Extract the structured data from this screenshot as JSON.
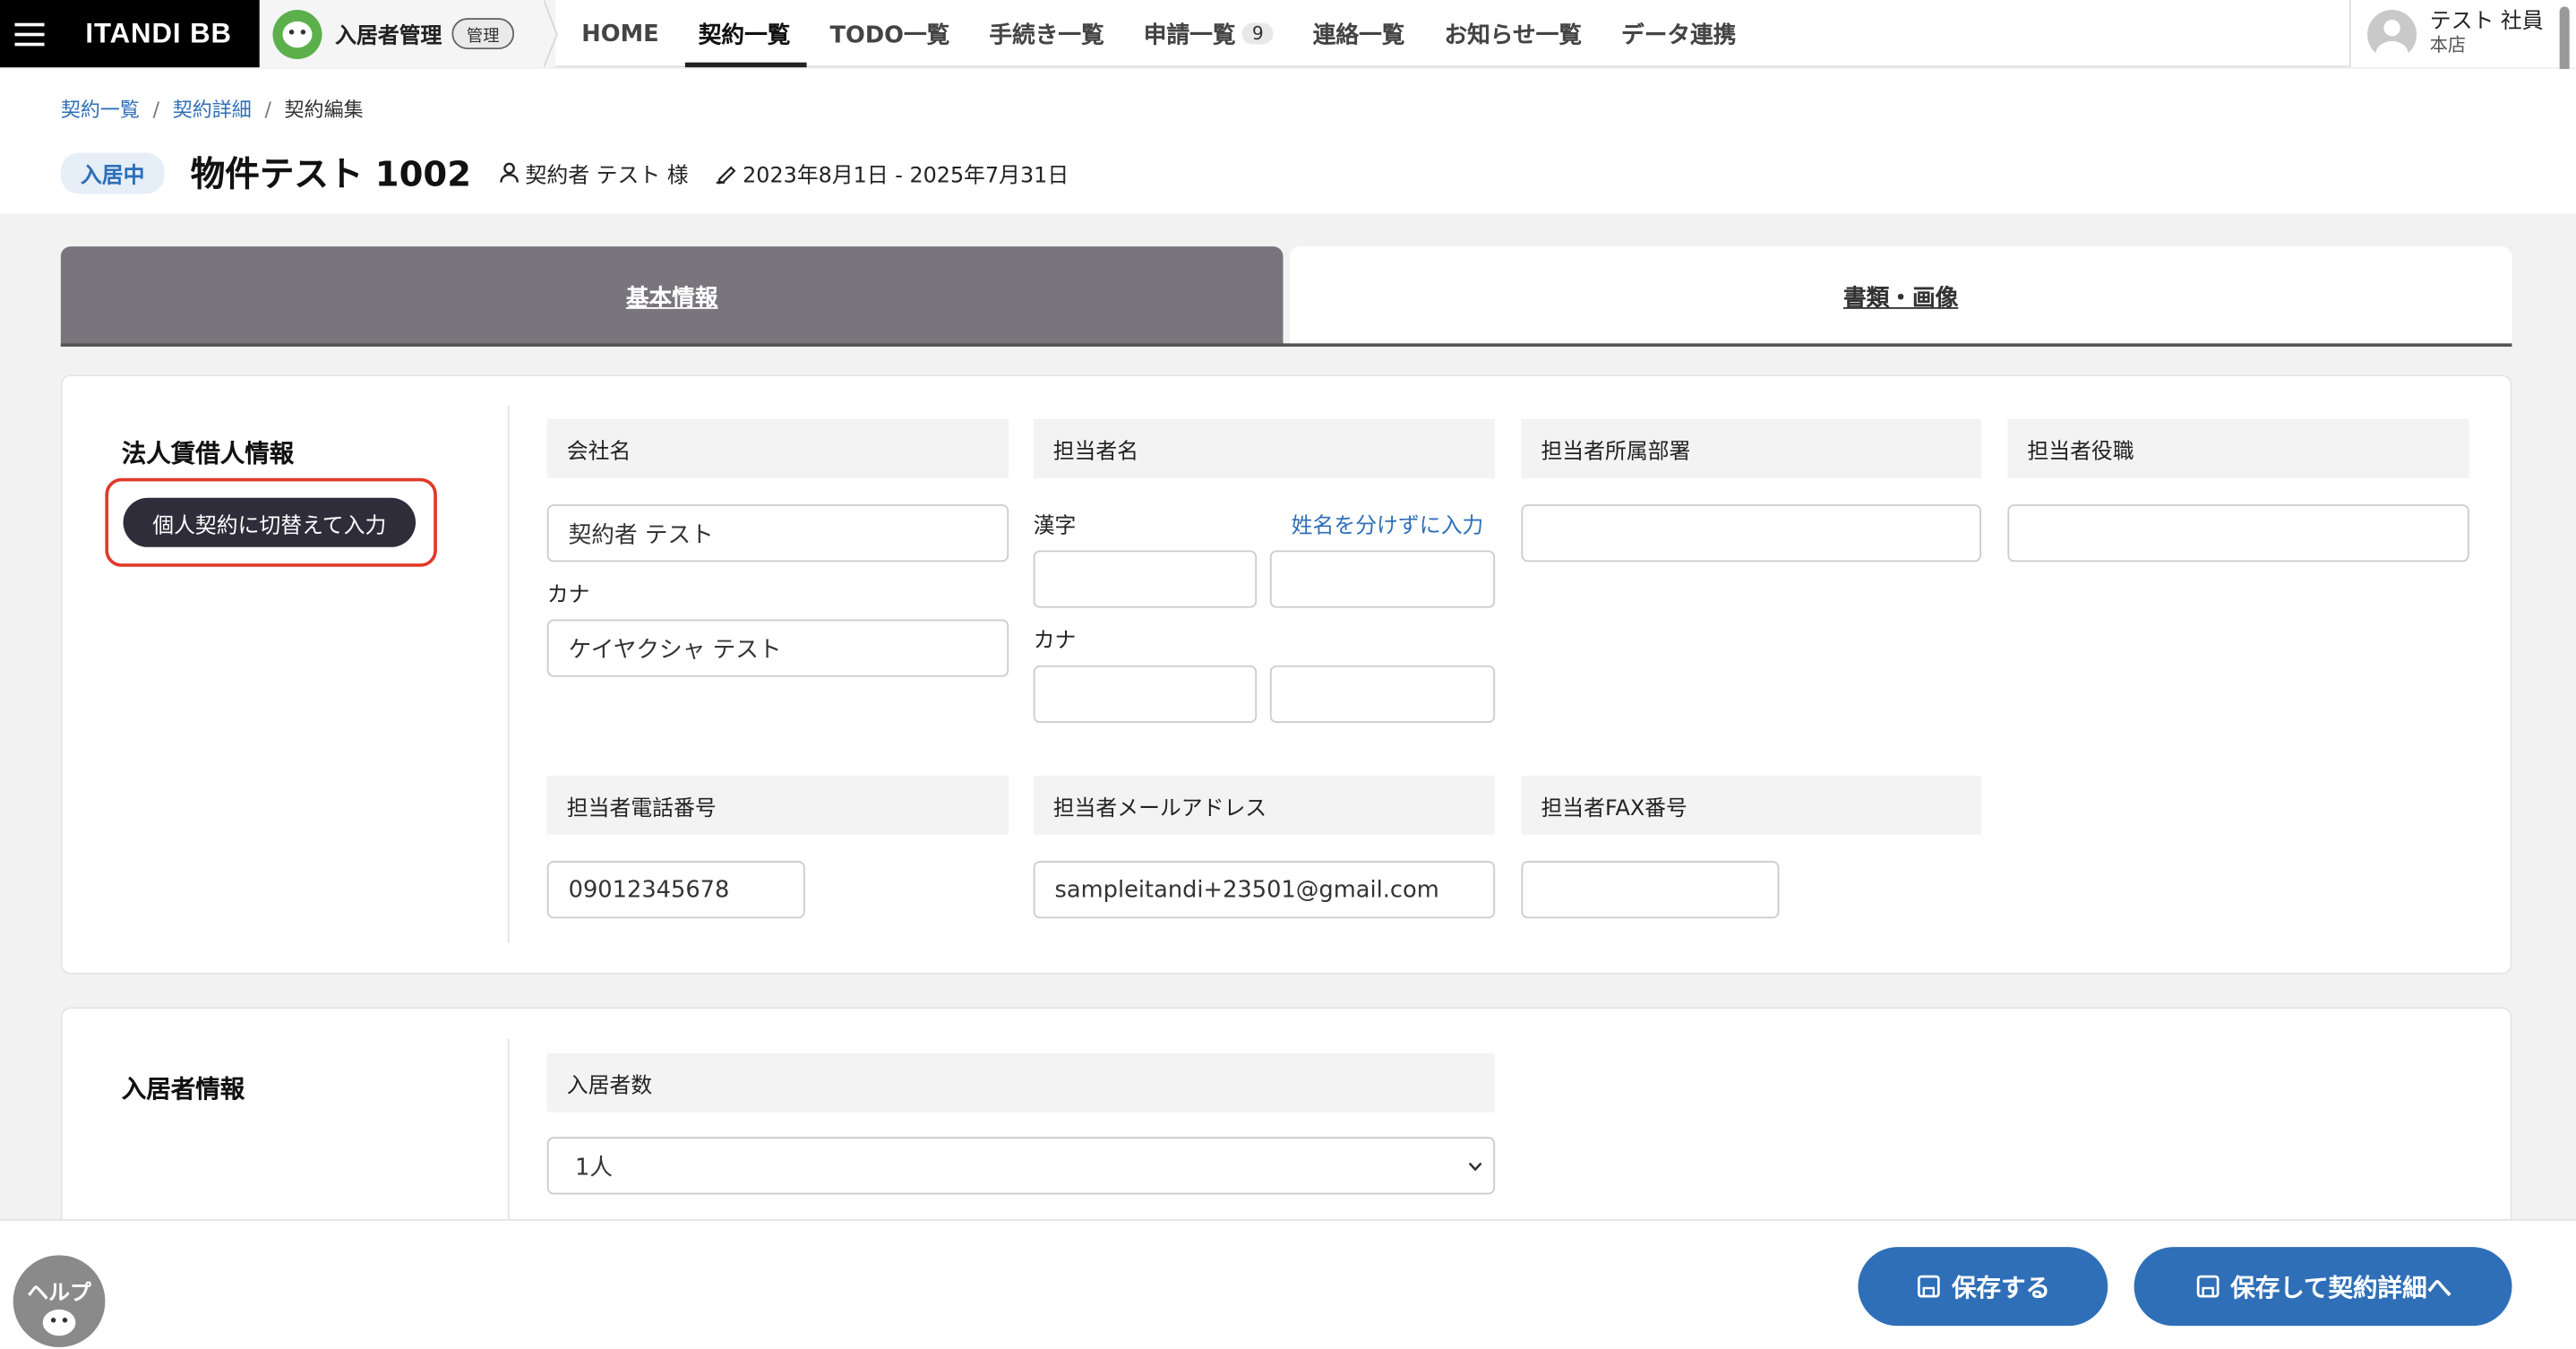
{
  "nav": {
    "logo": "ITANDI BB",
    "product": "入居者管理",
    "product_badge": "管理",
    "items": [
      {
        "label": "HOME"
      },
      {
        "label": "契約一覧"
      },
      {
        "label": "TODO一覧"
      },
      {
        "label": "手続き一覧"
      },
      {
        "label": "申請一覧",
        "count": "9"
      },
      {
        "label": "連絡一覧"
      },
      {
        "label": "お知らせ一覧"
      },
      {
        "label": "データ連携"
      }
    ],
    "active_item": "契約一覧",
    "user_name": "テスト 社員",
    "user_store": "本店"
  },
  "breadcrumb": {
    "items": [
      "契約一覧",
      "契約詳細",
      "契約編集"
    ],
    "sep": "/"
  },
  "header": {
    "status": "入居中",
    "title": "物件テスト 1002",
    "contractor": "契約者 テスト 様",
    "period": "2023年8月1日 - 2025年7月31日"
  },
  "tabs": [
    {
      "label": "基本情報",
      "active": true
    },
    {
      "label": "書類・画像",
      "active": false
    }
  ],
  "corporate": {
    "section_title": "法人賃借人情報",
    "switch_button": "個人契約に切替えて入力",
    "company_name_header": "会社名",
    "company_name_value": "契約者 テスト",
    "kana_label": "カナ",
    "company_kana_value": "ケイヤクシャ テスト",
    "person_name_header": "担当者名",
    "kanji_label": "漢字",
    "no_split_link": "姓名を分けずに入力",
    "person_kana_label": "カナ",
    "dept_header": "担当者所属部署",
    "position_header": "担当者役職",
    "phone_header": "担当者電話番号",
    "phone_value": "09012345678",
    "email_header": "担当者メールアドレス",
    "email_value": "sampleitandi+23501@gmail.com",
    "fax_header": "担当者FAX番号"
  },
  "resident": {
    "section_title": "入居者情報",
    "count_header": "入居者数",
    "count_value": "1人"
  },
  "actions": {
    "save": "保存する",
    "save_and_detail": "保存して契約詳細へ"
  },
  "help": {
    "label": "ヘルプ"
  },
  "colors": {
    "accent_blue": "#2f6fb7",
    "active_tab": "#79757d",
    "highlight_red": "#e0392b",
    "dark_button": "#2f2d3a"
  }
}
